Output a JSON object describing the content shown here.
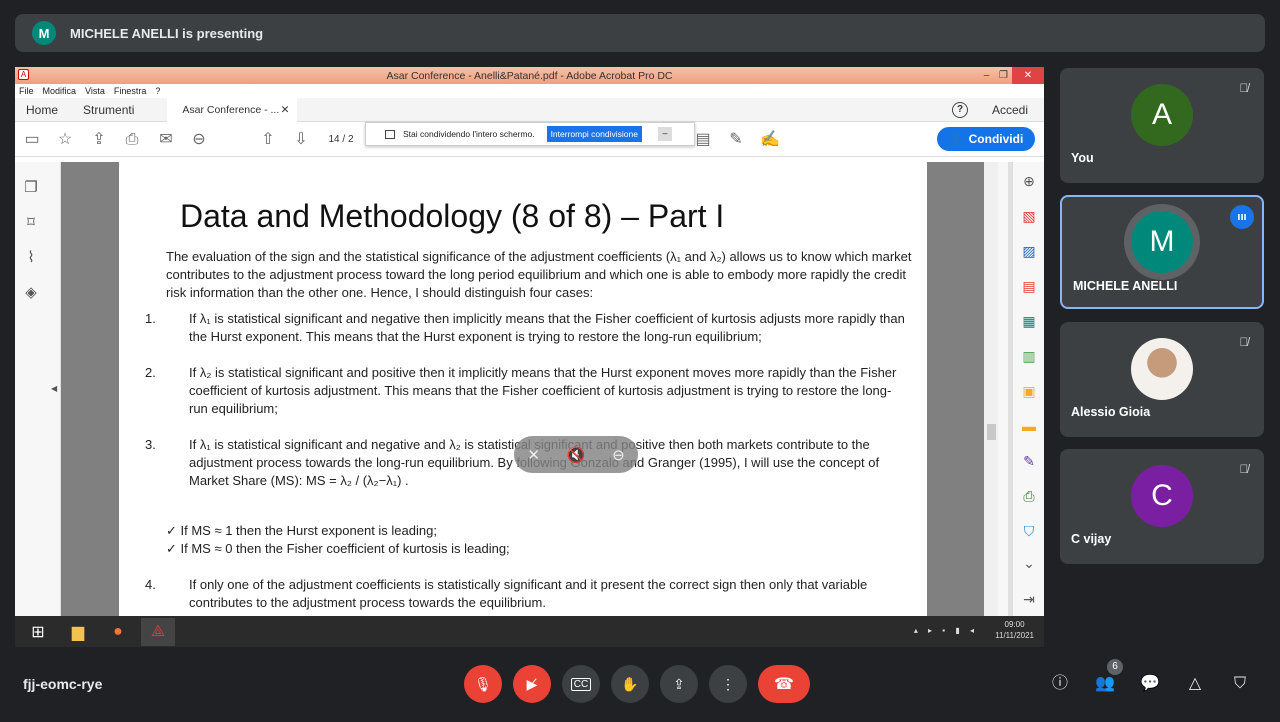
{
  "meet": {
    "presenting_initial": "M",
    "presenting_text": "MICHELE ANELLI is presenting",
    "meeting_code": "fjj-eomc-rye",
    "people_count": "6"
  },
  "acrobat": {
    "window_title": "Asar Conference - Anelli&Patané.pdf - Adobe Acrobat Pro DC",
    "menu": [
      "File",
      "Modifica",
      "Vista",
      "Finestra",
      "?"
    ],
    "tab_home": "Home",
    "tab_tools": "Strumenti",
    "tab_doc": "Asar Conference - ...",
    "login": "Accedi",
    "page_number": "14 / 2",
    "share_button": "Condividi",
    "banner_text": "Stai condividendo l'intero schermo.",
    "banner_stop": "Interrompi condivisione",
    "clock_time": "09:00",
    "clock_date": "11/11/2021"
  },
  "slide": {
    "title": "Data and Methodology (8 of 8) – Part I",
    "intro": "The evaluation of the sign and the statistical significance of the adjustment coefficients (λ₁ and λ₂) allows us to know which market contributes to the adjustment process toward the long period equilibrium and which one is able to embody more rapidly the credit risk information than the other one. Hence, I should distinguish four cases:",
    "case1": "If λ₁ is statistical significant and negative then implicitly means that the Fisher coefficient of kurtosis adjusts more rapidly than the Hurst exponent. This means that the Hurst exponent is trying to restore the long-run equilibrium;",
    "case2": "If λ₂ is statistical significant and positive then it implicitly means that the Hurst exponent moves more rapidly than the Fisher coefficient of kurtosis adjustment. This means that the Fisher coefficient of kurtosis adjustment is trying to restore the long-run equilibrium;",
    "case3": "If λ₁ is statistical significant and negative and λ₂ is statistical significant and positive then both markets contribute to the adjustment process towards the long-run equilibrium. By following Gonzalo and Granger (1995), I will use the concept of Market Share (MS): MS = λ₂ / (λ₂−λ₁) .",
    "check1": "✓  If MS ≈ 1 then the Hurst exponent is leading;",
    "check2": "✓  If MS ≈ 0 then the Fisher coefficient of kurtosis is leading;",
    "case4": "If only one of the adjustment coefficients is statistically significant and it present the correct sign then only that variable contributes to the adjustment process towards the equilibrium.",
    "n1": "1.",
    "n2": "2.",
    "n3": "3.",
    "n4": "4."
  },
  "participants": [
    {
      "initial": "A",
      "name": "You",
      "color": "#33691e"
    },
    {
      "initial": "M",
      "name": "MICHELE ANELLI",
      "color": "#00897b"
    },
    {
      "initial": "",
      "name": "Alessio Gioia",
      "color": "#c69b7b"
    },
    {
      "initial": "C",
      "name": "C vijay",
      "color": "#7b1fa2"
    }
  ]
}
